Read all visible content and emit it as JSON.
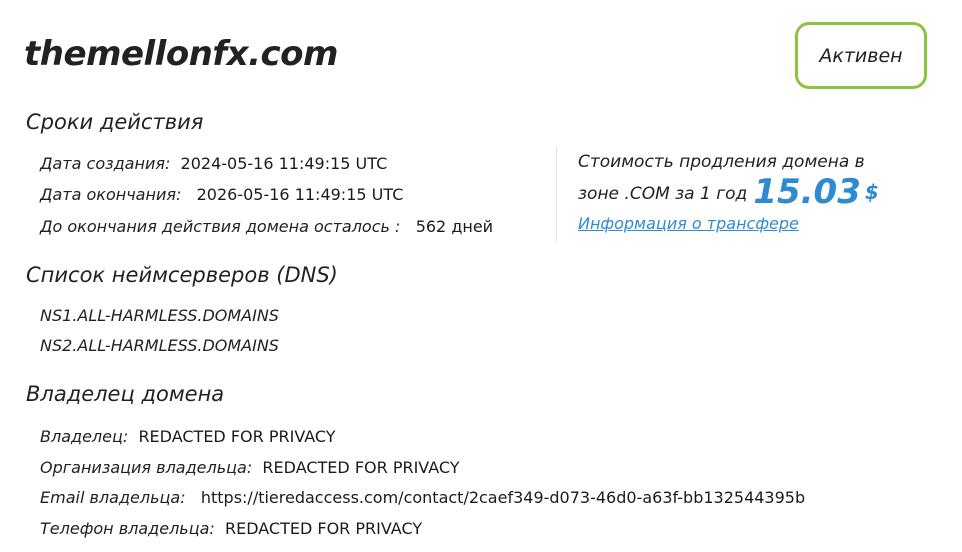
{
  "domain": "themellonfx.com",
  "status": "Активен",
  "validity": {
    "title": "Сроки действия",
    "created_label": "Дата создания:",
    "created_value": "2024-05-16 11:49:15 UTC",
    "expires_label": "Дата окончания:",
    "expires_value": "2026-05-16 11:49:15 UTC",
    "remaining_label": "До окончания действия домена осталось :",
    "remaining_value": "562 дней"
  },
  "renewal": {
    "text": "Стоимость продления домена в зоне .COM за 1 год",
    "price": "15.03",
    "currency": "$",
    "transfer_link": "Информация о трансфере"
  },
  "dns": {
    "title": "Список неймсерверов (DNS)",
    "servers": [
      "NS1.ALL-HARMLESS.DOMAINS",
      "NS2.ALL-HARMLESS.DOMAINS"
    ]
  },
  "owner": {
    "title": "Владелец домена",
    "owner_label": "Владелец:",
    "owner_value": "REDACTED FOR PRIVACY",
    "org_label": "Организация владельца:",
    "org_value": "REDACTED FOR PRIVACY",
    "email_label": "Email владельца:",
    "email_value": "https://tieredaccess.com/contact/2caef349-d073-46d0-a63f-bb132544395b",
    "phone_label": "Телефон владельца:",
    "phone_value": "REDACTED FOR PRIVACY"
  }
}
